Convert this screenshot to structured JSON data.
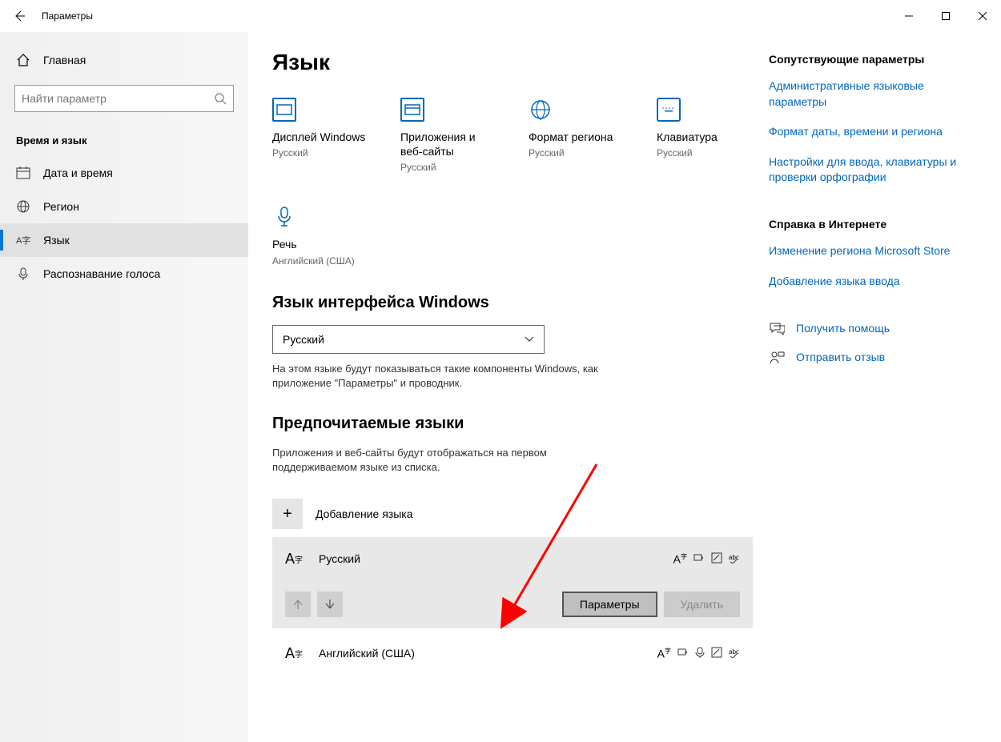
{
  "titlebar": {
    "title": "Параметры"
  },
  "sidebar": {
    "home": "Главная",
    "search_placeholder": "Найти параметр",
    "category": "Время и язык",
    "items": [
      {
        "label": "Дата и время"
      },
      {
        "label": "Регион"
      },
      {
        "label": "Язык"
      },
      {
        "label": "Распознавание голоса"
      }
    ]
  },
  "page": {
    "title": "Язык",
    "tiles": [
      {
        "label": "Дисплей Windows",
        "sub": "Русский"
      },
      {
        "label": "Приложения и веб-сайты",
        "sub": "Русский"
      },
      {
        "label": "Формат региона",
        "sub": "Русский"
      },
      {
        "label": "Клавиатура",
        "sub": "Русский"
      },
      {
        "label": "Речь",
        "sub": "Английский (США)"
      }
    ],
    "display_lang": {
      "heading": "Язык интерфейса Windows",
      "selected": "Русский",
      "desc": "На этом языке будут показываться такие компоненты Windows, как приложение \"Параметры\" и проводник."
    },
    "preferred": {
      "heading": "Предпочитаемые языки",
      "desc": "Приложения и веб-сайты будут отображаться на первом поддерживаемом языке из списка.",
      "add": "Добавление языка",
      "langs": [
        {
          "name": "Русский"
        },
        {
          "name": "Английский (США)"
        }
      ],
      "btn_options": "Параметры",
      "btn_remove": "Удалить"
    }
  },
  "right": {
    "related_header": "Сопутствующие параметры",
    "links": [
      "Административные языковые параметры",
      "Формат даты, времени и региона",
      "Настройки для ввода, клавиатуры и проверки орфографии"
    ],
    "help_header": "Справка в Интернете",
    "help_links": [
      "Изменение региона Microsoft Store",
      "Добавление языка ввода"
    ],
    "get_help": "Получить помощь",
    "feedback": "Отправить отзыв"
  }
}
